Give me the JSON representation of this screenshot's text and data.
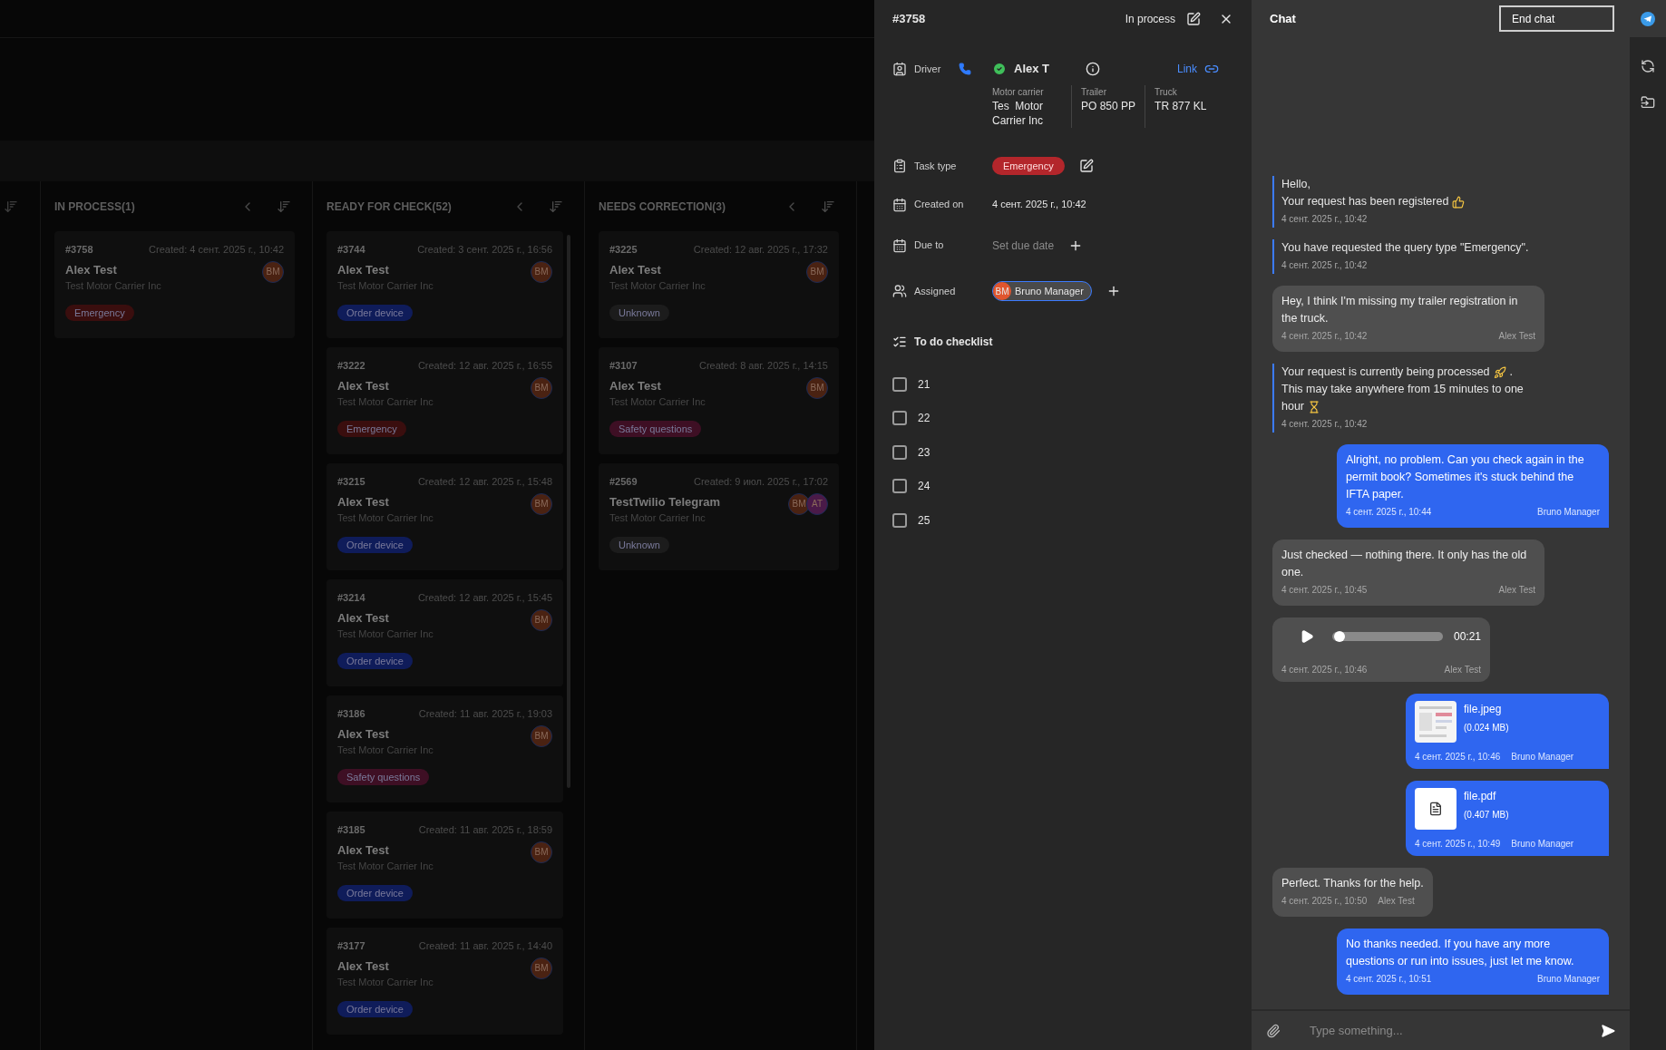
{
  "board": {
    "columns": [
      {
        "title": "IN PROCESS(1)",
        "cards": [
          {
            "id": "#3758",
            "created": "Created: 4 сент. 2025 г., 10:42",
            "name": "Alex Test",
            "company": "Test Motor Carrier Inc",
            "tag": {
              "label": "Emergency",
              "color": "#3a0e0e"
            },
            "avatars": [
              {
                "initials": "BM",
                "color": "#4a2212"
              }
            ]
          }
        ]
      },
      {
        "title": "READY FOR CHECK(52)",
        "cards": [
          {
            "id": "#3744",
            "created": "Created: 3 сент. 2025 г., 16:56",
            "name": "Alex Test",
            "company": "Test Motor Carrier Inc",
            "tag": {
              "label": "Order device",
              "color": "#0f1c5a"
            },
            "avatars": [
              {
                "initials": "BM",
                "color": "#4a2212"
              }
            ]
          },
          {
            "id": "#3222",
            "created": "Created: 12 авг. 2025 г., 16:55",
            "name": "Alex Test",
            "company": "Test Motor Carrier Inc",
            "tag": {
              "label": "Emergency",
              "color": "#3a0e0e"
            },
            "avatars": [
              {
                "initials": "BM",
                "color": "#4a2212"
              }
            ]
          },
          {
            "id": "#3215",
            "created": "Created: 12 авг. 2025 г., 15:48",
            "name": "Alex Test",
            "company": "Test Motor Carrier Inc",
            "tag": {
              "label": "Order device",
              "color": "#0f1c5a"
            },
            "avatars": [
              {
                "initials": "BM",
                "color": "#4a2212"
              }
            ]
          },
          {
            "id": "#3214",
            "created": "Created: 12 авг. 2025 г., 15:45",
            "name": "Alex Test",
            "company": "Test Motor Carrier Inc",
            "tag": {
              "label": "Order device",
              "color": "#0f1c5a"
            },
            "avatars": [
              {
                "initials": "BM",
                "color": "#4a2212"
              }
            ]
          },
          {
            "id": "#3186",
            "created": "Created: 11 авг. 2025 г., 19:03",
            "name": "Alex Test",
            "company": "Test Motor Carrier Inc",
            "tag": {
              "label": "Safety questions",
              "color": "#3e0f24"
            },
            "avatars": [
              {
                "initials": "BM",
                "color": "#4a2212"
              }
            ]
          },
          {
            "id": "#3185",
            "created": "Created: 11 авг. 2025 г., 18:59",
            "name": "Alex Test",
            "company": "Test Motor Carrier Inc",
            "tag": {
              "label": "Order device",
              "color": "#0f1c5a"
            },
            "avatars": [
              {
                "initials": "BM",
                "color": "#4a2212"
              }
            ]
          },
          {
            "id": "#3177",
            "created": "Created: 11 авг. 2025 г., 14:40",
            "name": "Alex Test",
            "company": "Test Motor Carrier Inc",
            "tag": {
              "label": "Order device",
              "color": "#0f1c5a"
            },
            "avatars": [
              {
                "initials": "BM",
                "color": "#4a2212"
              }
            ]
          }
        ]
      },
      {
        "title": "NEEDS CORRECTION(3)",
        "cards": [
          {
            "id": "#3225",
            "created": "Created: 12 авг. 2025 г., 17:32",
            "name": "Alex Test",
            "company": "Test Motor Carrier Inc",
            "tag": {
              "label": "Unknown",
              "color": "#1c1c1c"
            },
            "avatars": [
              {
                "initials": "BM",
                "color": "#4a2212"
              }
            ]
          },
          {
            "id": "#3107",
            "created": "Created: 8 авг. 2025 г., 14:15",
            "name": "Alex Test",
            "company": "Test Motor Carrier Inc",
            "tag": {
              "label": "Safety questions",
              "color": "#3e0f24"
            },
            "avatars": [
              {
                "initials": "BM",
                "color": "#4a2212"
              }
            ]
          },
          {
            "id": "#2569",
            "created": "Created: 9 июл. 2025 г., 17:02",
            "name": "TestTwilio Telegram",
            "company": "Test Motor Carrier Inc",
            "tag": {
              "label": "Unknown",
              "color": "#1c1c1c"
            },
            "avatars": [
              {
                "initials": "BM",
                "color": "#4a2212"
              },
              {
                "initials": "AT",
                "color": "#4a1a48"
              }
            ]
          }
        ]
      }
    ]
  },
  "details": {
    "id": "#3758",
    "status": "In process",
    "driver": {
      "label": "Driver",
      "name": "Alex T",
      "online": true,
      "link": "Link"
    },
    "vehicle": [
      {
        "label": "Motor carrier",
        "value": "Tes  Motor Carrier Inc"
      },
      {
        "label": "Trailer",
        "value": "PO 850 PP"
      },
      {
        "label": "Truck",
        "value": "TR 877 KL"
      }
    ],
    "task_type": {
      "label": "Task type",
      "value": "Emergency",
      "color": "#b3262b"
    },
    "created_on": {
      "label": "Created on",
      "value": "4 сент. 2025 г., 10:42"
    },
    "due_to": {
      "label": "Due to",
      "placeholder": "Set due date"
    },
    "assigned": {
      "label": "Assigned",
      "people": [
        {
          "initials": "BM",
          "name": "Bruno Manager",
          "color": "#e0552e"
        }
      ]
    },
    "checklist": {
      "title": "To do checklist",
      "items": [
        {
          "label": "21",
          "checked": false
        },
        {
          "label": "22",
          "checked": false
        },
        {
          "label": "23",
          "checked": false
        },
        {
          "label": "24",
          "checked": false
        },
        {
          "label": "25",
          "checked": false
        }
      ]
    }
  },
  "chat": {
    "title": "Chat",
    "end_button": "End chat",
    "input": {
      "placeholder": "Type something..."
    },
    "messages": [
      {
        "kind": "system",
        "lines": [
          [
            "Hello,"
          ],
          [
            "Your request has been registered"
          ]
        ],
        "time": "4 сент. 2025 г., 10:42"
      },
      {
        "kind": "system",
        "lines": [
          [
            "You have requested the query type \"Emergency\"."
          ]
        ],
        "time": "4 сент. 2025 г., 10:42"
      },
      {
        "kind": "incoming",
        "text": "Hey, I think I'm missing my trailer registration in the truck.",
        "time": "4 сент. 2025 г., 10:42",
        "author": "Alex Test"
      },
      {
        "kind": "system",
        "lines": [
          [
            "Your request is currently being processed",
            "."
          ],
          [
            "This may take anywhere from 15 minutes to one"
          ],
          [
            "hour"
          ]
        ],
        "time": "4 сент. 2025 г., 10:42"
      },
      {
        "kind": "outgoing",
        "text": "Alright, no problem. Can you check again in the permit book? Sometimes it's stuck behind the IFTA paper.",
        "time": "4 сент. 2025 г., 10:44",
        "author": "Bruno Manager"
      },
      {
        "kind": "incoming",
        "text": "Just checked — nothing there. It only has the old one.",
        "time": "4 сент. 2025 г., 10:45",
        "author": "Alex Test"
      },
      {
        "kind": "audio",
        "duration": "00:21",
        "level": 0.02,
        "time": "4 сент. 2025 г., 10:46",
        "author": "Alex Test"
      },
      {
        "name": "file.jpeg",
        "size": "(0.024 MB)",
        "time": "4 сент. 2025 г., 10:46",
        "author": "Bruno Manager"
      },
      {
        "kind": "document",
        "name": "file.pdf",
        "size": "(0.407 MB)",
        "time": "4 сент. 2025 г., 10:49",
        "author": "Bruno Manager"
      },
      {
        "kind": "incoming",
        "text": "Perfect. Thanks for the help.",
        "time": "4 сент. 2025 г., 10:50",
        "author": "Alex Test"
      },
      {
        "kind": "outgoing",
        "text": "No thanks needed. If you have any more questions or run into issues, just let me know.",
        "time": "4 сент. 2025 г., 10:51",
        "author": "Bruno Manager"
      }
    ]
  }
}
